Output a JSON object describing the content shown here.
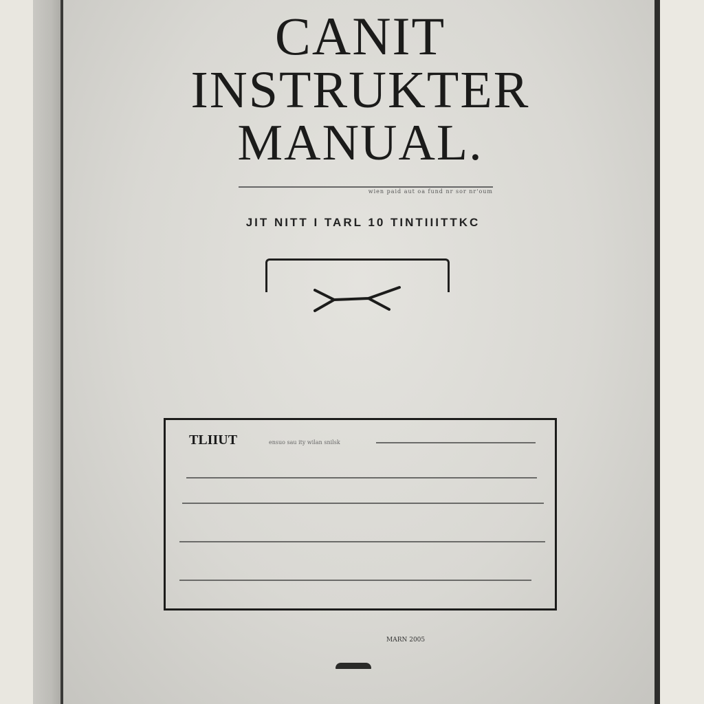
{
  "cover": {
    "title_line1": "CANIT",
    "title_line2": "INSTRUKTER",
    "title_line3": "MANUAL.",
    "rule_text": "wien  paid aut oa fund  nr   sor nr'oum",
    "subtitle": "JIT NITT I  TARL 10 TINTIIITTKC",
    "label_box": {
      "title": "TLIIUT",
      "note": "ensuo sau ity wilan snilsk"
    },
    "footer_text": "MARN 2005"
  }
}
